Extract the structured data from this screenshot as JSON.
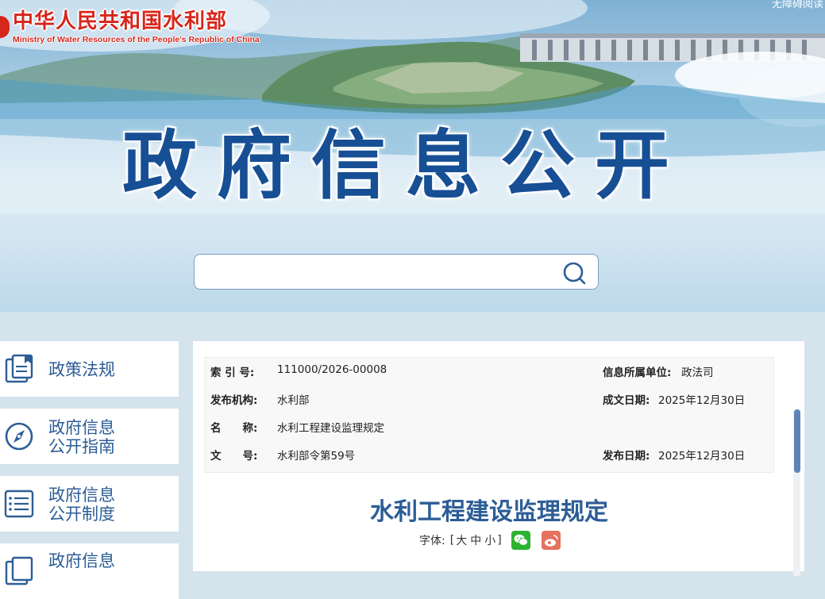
{
  "header": {
    "site_name_cn": "中华人民共和国水利部",
    "site_name_en": "Ministry of Water Resources of the People's Republic of China",
    "corner_link": "无障碍阅读",
    "page_title": "政府信息公开"
  },
  "search": {
    "placeholder": ""
  },
  "sidebar": {
    "items": [
      {
        "label": "政策法规",
        "icon": "document-icon"
      },
      {
        "label": "政府信息\n公开指南",
        "icon": "compass-icon"
      },
      {
        "label": "政府信息\n公开制度",
        "icon": "list-icon"
      },
      {
        "label": "政府信息",
        "icon": "document-icon"
      }
    ]
  },
  "meta": {
    "index_no_label": "索 引 号:",
    "index_no": "111000/2026-00008",
    "unit_label": "信息所属单位:",
    "unit": "政法司",
    "publisher_label": "发布机构:",
    "publisher": "水利部",
    "created_label": "成文日期:",
    "created": "2025年12月30日",
    "name_label": "名　　称:",
    "name": "水利工程建设监理规定",
    "docno_label": "文　　号:",
    "docno": "水利部令第59号",
    "published_label": "发布日期:",
    "published": "2025年12月30日"
  },
  "article": {
    "title": "水利工程建设监理规定",
    "font_label": "字体:",
    "bracket_open": "[",
    "size_large": "大",
    "size_medium": "中",
    "size_small": "小",
    "bracket_close": "]"
  },
  "colors": {
    "brand_red": "#d7261c",
    "title_blue": "#174f95",
    "link_blue": "#2c5d96",
    "wechat_green": "#2bb331",
    "weibo_red": "#e6715f"
  }
}
